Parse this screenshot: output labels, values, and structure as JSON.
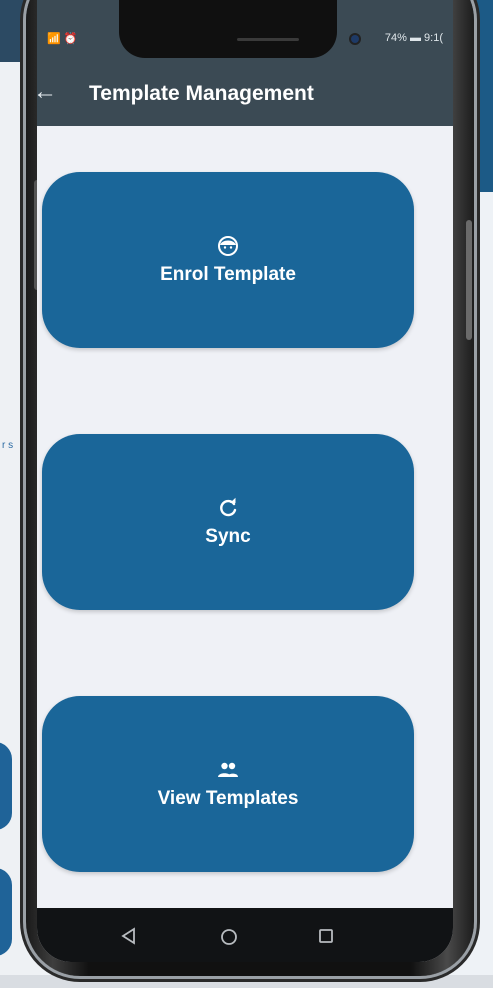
{
  "status_bar": {
    "left_icons": "📶 ⏰",
    "right": "74% ▬ 9:1("
  },
  "app_bar": {
    "back_icon": "arrow-back-icon",
    "title": "Template Management"
  },
  "actions": [
    {
      "label": "Enrol Template",
      "icon": "face-icon"
    },
    {
      "label": "Sync",
      "icon": "sync-icon"
    },
    {
      "label": "View Templates",
      "icon": "people-icon"
    }
  ],
  "nav_bar": {
    "back_icon": "triangle-back-icon",
    "home_icon": "circle-home-icon",
    "recents_icon": "square-recents-icon"
  },
  "colors": {
    "app_bar": "#3b4a54",
    "button": "#1a6699",
    "screen_bg": "#eff1f6",
    "nav_bar": "#111315"
  }
}
